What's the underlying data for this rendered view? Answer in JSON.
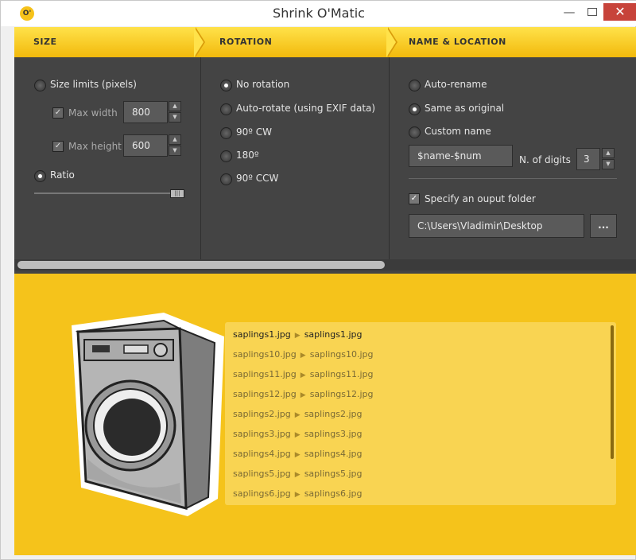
{
  "window": {
    "title": "Shrink O'Matic",
    "app_icon_label": "O'",
    "minimize": "—",
    "close": "✕"
  },
  "sections": {
    "size": "SIZE",
    "rotation": "ROTATION",
    "name_location": "NAME & LOCATION"
  },
  "size": {
    "size_limits_label": "Size limits (pixels)",
    "max_width_label": "Max width",
    "max_width_value": "800",
    "max_height_label": "Max height",
    "max_height_value": "600",
    "ratio_label": "Ratio",
    "selected": "ratio",
    "slider_level_fraction": 1.0
  },
  "rotation": {
    "options": [
      "No rotation",
      "Auto-rotate (using EXIF data)",
      "90º CW",
      "180º",
      "90º CCW"
    ],
    "selected": "No rotation"
  },
  "name_location": {
    "options": [
      "Auto-rename",
      "Same as original",
      "Custom name"
    ],
    "selected": "Same as original",
    "custom_name_value": "$name-$num",
    "digits_label": "N. of digits",
    "digits_value": "3",
    "output_folder_label": "Specify an ouput folder",
    "output_folder_checked": true,
    "folder_path": "C:\\Users\\Vladimir\\Desktop",
    "browse_label": "..."
  },
  "files": [
    {
      "src": "saplings1.jpg",
      "dst": "saplings1.jpg"
    },
    {
      "src": "saplings10.jpg",
      "dst": "saplings10.jpg"
    },
    {
      "src": "saplings11.jpg",
      "dst": "saplings11.jpg"
    },
    {
      "src": "saplings12.jpg",
      "dst": "saplings12.jpg"
    },
    {
      "src": "saplings2.jpg",
      "dst": "saplings2.jpg"
    },
    {
      "src": "saplings3.jpg",
      "dst": "saplings3.jpg"
    },
    {
      "src": "saplings4.jpg",
      "dst": "saplings4.jpg"
    },
    {
      "src": "saplings5.jpg",
      "dst": "saplings5.jpg"
    },
    {
      "src": "saplings6.jpg",
      "dst": "saplings6.jpg"
    }
  ],
  "colors": {
    "accent_yellow": "#f5c31b",
    "panel_dark": "#444444"
  }
}
